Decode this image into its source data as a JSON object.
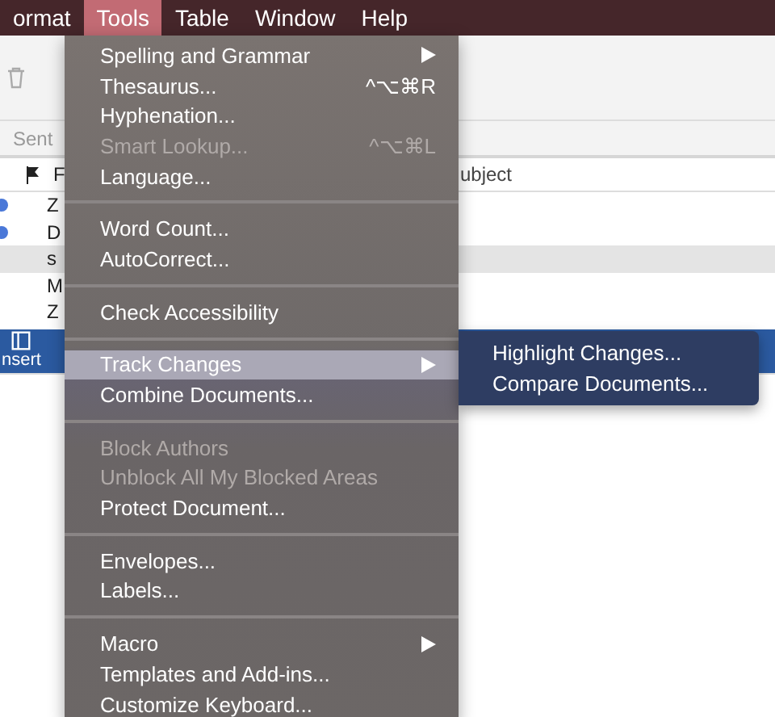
{
  "menubar": {
    "items": [
      {
        "label": "ormat",
        "selected": false
      },
      {
        "label": "Tools",
        "selected": true
      },
      {
        "label": "Table",
        "selected": false
      },
      {
        "label": "Window",
        "selected": false
      },
      {
        "label": "Help",
        "selected": false
      }
    ]
  },
  "background_window": {
    "folder": "Sent",
    "columns": [
      "F",
      "ubject"
    ],
    "rows": [
      {
        "sender": "Z",
        "unread": true,
        "selected": false
      },
      {
        "sender": "D",
        "unread": true,
        "selected": false
      },
      {
        "sender": "s",
        "unread": false,
        "selected": true
      },
      {
        "sender": "M",
        "unread": false,
        "selected": false
      },
      {
        "sender": "Z",
        "unread": false,
        "selected": false
      }
    ],
    "ribbon_tab": "nsert"
  },
  "tools_menu": {
    "sections": [
      [
        {
          "label": "Spelling and Grammar",
          "submenu": true,
          "disabled": false,
          "selected": false
        },
        {
          "label": "Thesaurus...",
          "shortcut": "^⌥⌘R",
          "submenu": false,
          "disabled": false,
          "selected": false
        },
        {
          "label": "Hyphenation...",
          "submenu": false,
          "disabled": false,
          "selected": false
        },
        {
          "label": "Smart Lookup...",
          "shortcut": "^⌥⌘L",
          "submenu": false,
          "disabled": true,
          "selected": false
        },
        {
          "label": "Language...",
          "submenu": false,
          "disabled": false,
          "selected": false
        }
      ],
      [
        {
          "label": "Word Count...",
          "submenu": false,
          "disabled": false,
          "selected": false
        },
        {
          "label": "AutoCorrect...",
          "submenu": false,
          "disabled": false,
          "selected": false
        }
      ],
      [
        {
          "label": "Check Accessibility",
          "submenu": false,
          "disabled": false,
          "selected": false
        }
      ],
      [
        {
          "label": "Track Changes",
          "submenu": true,
          "disabled": false,
          "selected": true
        },
        {
          "label": "Combine Documents...",
          "submenu": false,
          "disabled": false,
          "selected": false
        }
      ],
      [
        {
          "label": "Block Authors",
          "submenu": false,
          "disabled": true,
          "selected": false
        },
        {
          "label": "Unblock All My Blocked Areas",
          "submenu": false,
          "disabled": true,
          "selected": false
        },
        {
          "label": "Protect Document...",
          "submenu": false,
          "disabled": false,
          "selected": false
        }
      ],
      [
        {
          "label": "Envelopes...",
          "submenu": false,
          "disabled": false,
          "selected": false
        },
        {
          "label": "Labels...",
          "submenu": false,
          "disabled": false,
          "selected": false
        }
      ],
      [
        {
          "label": "Macro",
          "submenu": true,
          "disabled": false,
          "selected": false
        },
        {
          "label": "Templates and Add-ins...",
          "submenu": false,
          "disabled": false,
          "selected": false
        },
        {
          "label": "Customize Keyboard...",
          "submenu": false,
          "disabled": false,
          "selected": false
        }
      ]
    ]
  },
  "track_changes_submenu": {
    "items": [
      {
        "label": "Highlight Changes...",
        "selected": false
      },
      {
        "label": "Compare Documents...",
        "selected": false
      }
    ]
  }
}
